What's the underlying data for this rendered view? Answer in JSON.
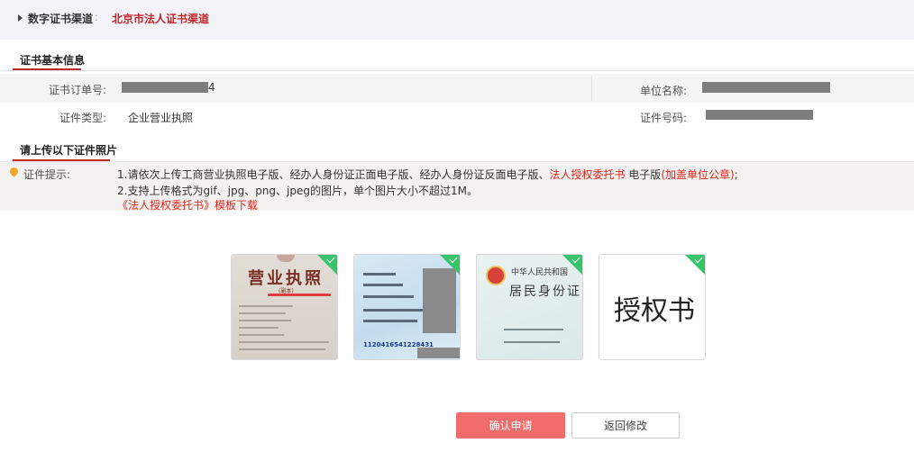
{
  "breadcrumb": {
    "root": "数字证书渠道",
    "separator": ":",
    "current": "北京市法人证书渠道"
  },
  "basic_section": {
    "title": "证书基本信息"
  },
  "fields": {
    "order_no_label": "证书订单号:",
    "order_no_suffix": "4",
    "unit_name_label": "单位名称:",
    "cert_type_label": "证件类型:",
    "cert_type_value": "企业营业执照",
    "cert_no_label": "证件号码:"
  },
  "upload_section": {
    "title": "请上传以下证件照片"
  },
  "hint": {
    "label": "证件提示:",
    "line1_a": "1.请依次上传工商营业执照电子版、经办人身份证正面电子版、经办人身份证反面电子版、",
    "line1_b": "法人授权委托书",
    "line1_c": "电子版",
    "line1_d": "(加盖单位公章)",
    "line1_e": ";",
    "line2": "2.支持上传格式为gif、jpg、png、jpeg的图片，单个图片大小不超过1M。",
    "template_link": "《法人授权委托书》模板下载"
  },
  "thumbs": {
    "license_title": "营业执照",
    "license_sub": "(副本)",
    "id_front_number": "1120416541228431",
    "id_back_t1": "中华人民共和国",
    "id_back_t2": "居民身份证",
    "auth_text": "授权书"
  },
  "buttons": {
    "confirm": "确认申请",
    "back": "返回修改"
  },
  "colors": {
    "accent": "#c0282d",
    "primary_button": "#f26c6c",
    "check_badge": "#35c46a",
    "link_red": "#e1251b"
  }
}
